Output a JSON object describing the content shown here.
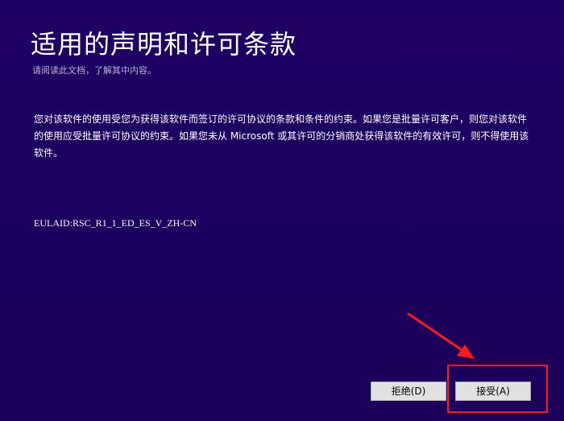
{
  "header": {
    "title": "适用的声明和许可条款",
    "subtitle": "请阅读此文档，了解其中内容。"
  },
  "license": {
    "body": "您对该软件的使用受您为获得该软件而签订的许可协议的条款和条件的约束。如果您是批量许可客户，则您对该软件的使用应受批量许可协议的约束。如果您未从 Microsoft 或其许可的分销商处获得该软件的有效许可，则不得使用该软件。",
    "eula_id": "EULAID:RSC_R1_1_ED_ES_V_ZH-CN"
  },
  "buttons": {
    "decline_label": "拒绝(D)",
    "accept_label": "接受(A)"
  },
  "colors": {
    "background": "#1e0060",
    "annotation": "#ff1a1a",
    "button_face": "#e1e1e1"
  }
}
